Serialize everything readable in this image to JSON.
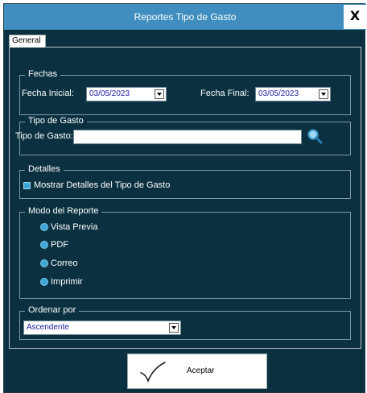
{
  "window": {
    "title": "Reportes Tipo de Gasto",
    "close_label": "X"
  },
  "tabs": [
    {
      "label": "General",
      "selected": true
    }
  ],
  "fechas": {
    "group_label": "Fechas",
    "inicial_label": "Fecha Inicial:",
    "inicial_value": "03/05/2023",
    "final_label": "Fecha Final:",
    "final_value": "03/05/2023"
  },
  "tipo_gasto": {
    "group_label": "Tipo de Gasto",
    "field_label": "Tipo de Gasto:",
    "field_value": "",
    "search_icon": "search-icon"
  },
  "detalles": {
    "group_label": "Detalles",
    "checkbox_label": "Mostrar Detalles del Tipo de Gasto"
  },
  "modo": {
    "group_label": "Modo del Reporte",
    "options": [
      "Vista Previa",
      "PDF",
      "Correo",
      "Imprimir"
    ]
  },
  "orden": {
    "group_label": "Ordenar por",
    "value": "Ascendente"
  },
  "actions": {
    "accept_label": "Aceptar",
    "accept_icon": "checkmark-icon"
  },
  "colors": {
    "titlebar": "#3f8ebf",
    "background": "#0b3140",
    "accent": "#3fa6d8"
  }
}
